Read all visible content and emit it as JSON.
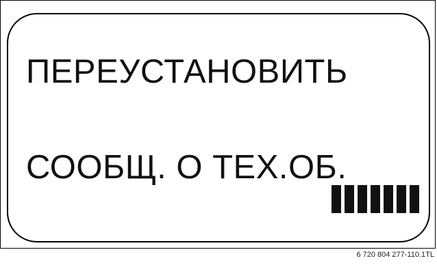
{
  "display": {
    "line1": "ПЕРЕУСТАНОВИТЬ",
    "line2": "СООБЩ. О ТЕХ.ОБ.",
    "progress_segments": 7
  },
  "figure_code": "6 720 804 277-110.1TL"
}
